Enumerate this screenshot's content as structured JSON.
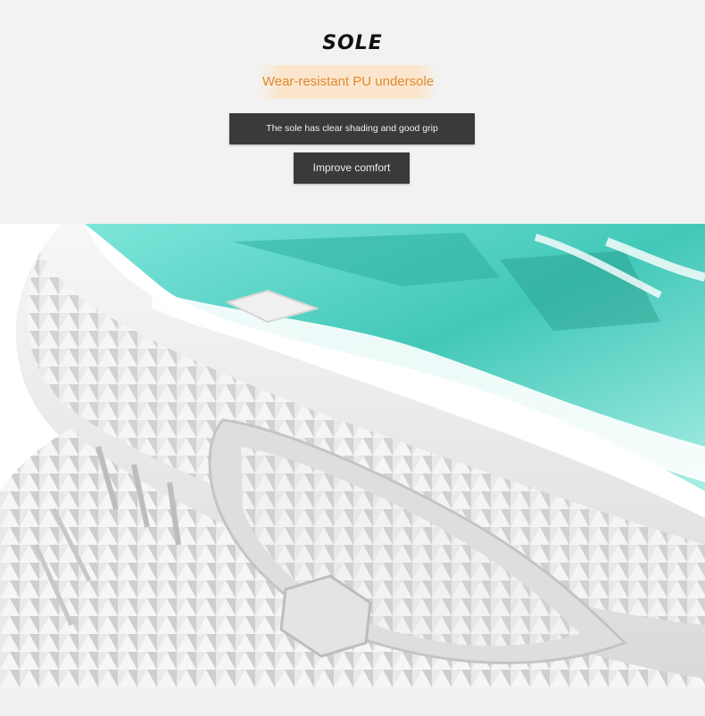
{
  "header": {
    "title": "SOLE",
    "subtitle": "Wear-resistant PU undersole",
    "feature_1": "The sole has clear shading and good grip",
    "feature_2": "Improve comfort"
  },
  "colors": {
    "accent_orange": "#e08a2e",
    "box_dark": "#3a3a3a",
    "shoe_teal": "#4fd3c4"
  }
}
